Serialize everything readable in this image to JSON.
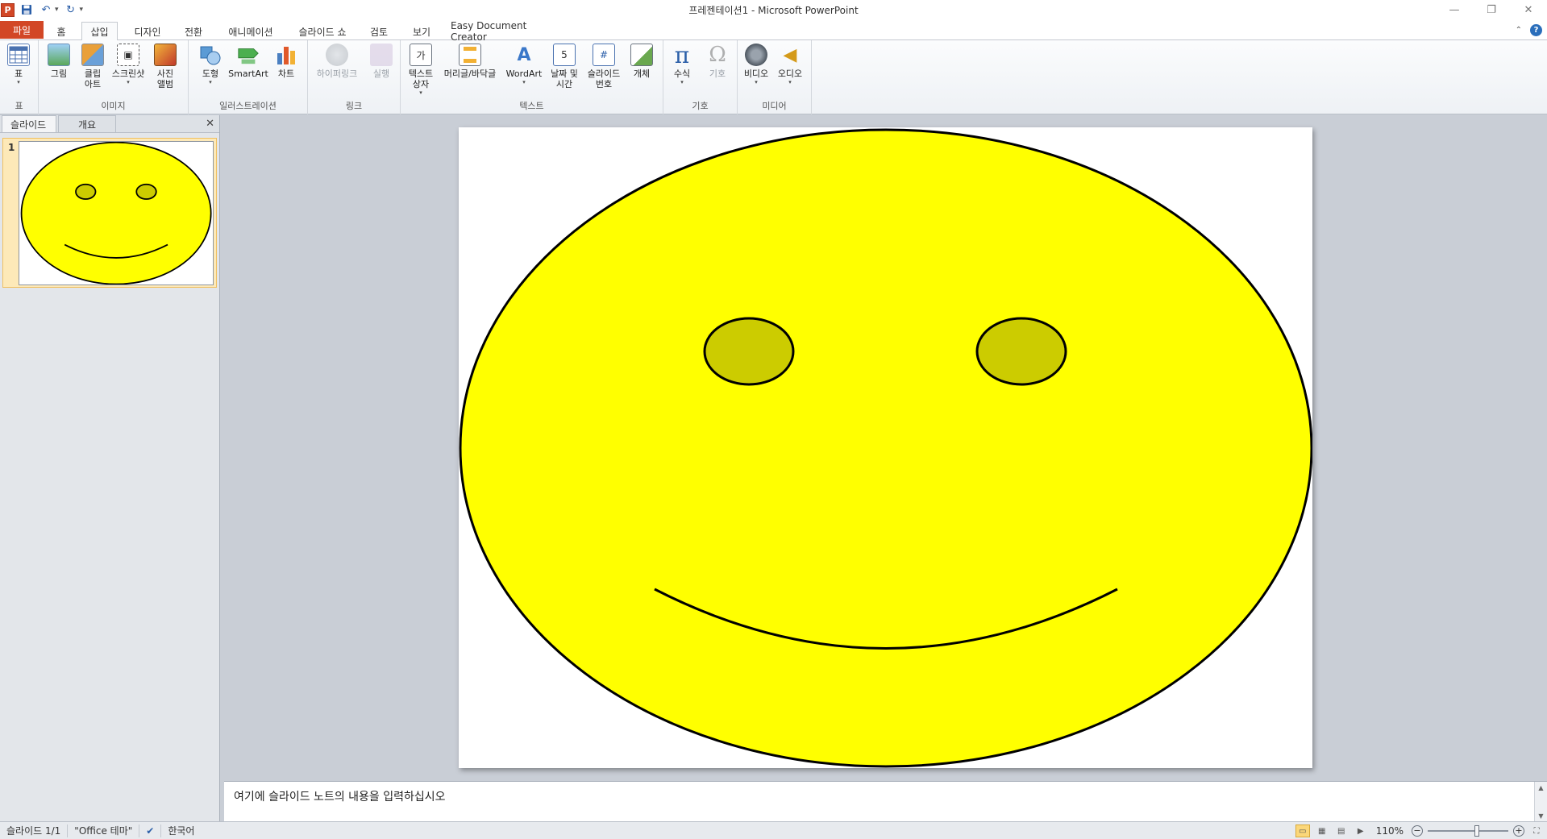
{
  "app": {
    "window_title": "프레젠테이션1  -  Microsoft PowerPoint",
    "logo_letter": "P"
  },
  "tabs": [
    {
      "label": "파일"
    },
    {
      "label": "홈"
    },
    {
      "label": "삽입"
    },
    {
      "label": "디자인"
    },
    {
      "label": "전환"
    },
    {
      "label": "애니메이션"
    },
    {
      "label": "슬라이드 쇼"
    },
    {
      "label": "검토"
    },
    {
      "label": "보기"
    },
    {
      "label": "Easy Document Creator"
    }
  ],
  "ribbon": {
    "groups": {
      "table": "표",
      "images": "이미지",
      "illustrations": "일러스트레이션",
      "links": "링크",
      "text": "텍스트",
      "symbols": "기호",
      "media": "미디어"
    },
    "buttons": {
      "table": "표",
      "picture": "그림",
      "clipart": "클립\n아트",
      "screenshot": "스크린샷",
      "album": "사진\n앨범",
      "shapes": "도형",
      "smartart": "SmartArt",
      "chart": "차트",
      "hyperlink": "하이퍼링크",
      "action": "실행",
      "textbox": "텍스트\n상자",
      "headerfooter": "머리글/바닥글",
      "wordart": "WordArt",
      "datetime": "날짜 및\n시간",
      "slidenumber": "슬라이드\n번호",
      "object": "개체",
      "equation": "수식",
      "symbol": "기호",
      "video": "비디오",
      "audio": "오디오"
    },
    "icon_glyphs": {
      "textbox": "가",
      "slidenumber": "#",
      "equation": "π",
      "symbol": "Ω"
    }
  },
  "left_panel": {
    "tabs": [
      "슬라이드",
      "개요"
    ],
    "slide_number": "1"
  },
  "notes": {
    "placeholder": "여기에 슬라이드 노트의 내용을 입력하십시오"
  },
  "status": {
    "slide": "슬라이드 1/1",
    "theme": "\"Office 테마\"",
    "language": "한국어",
    "zoom": "110%"
  },
  "colors": {
    "face": "#ffff00",
    "eyes": "#cccc00",
    "outline": "#000000",
    "file_tab": "#d24726"
  }
}
